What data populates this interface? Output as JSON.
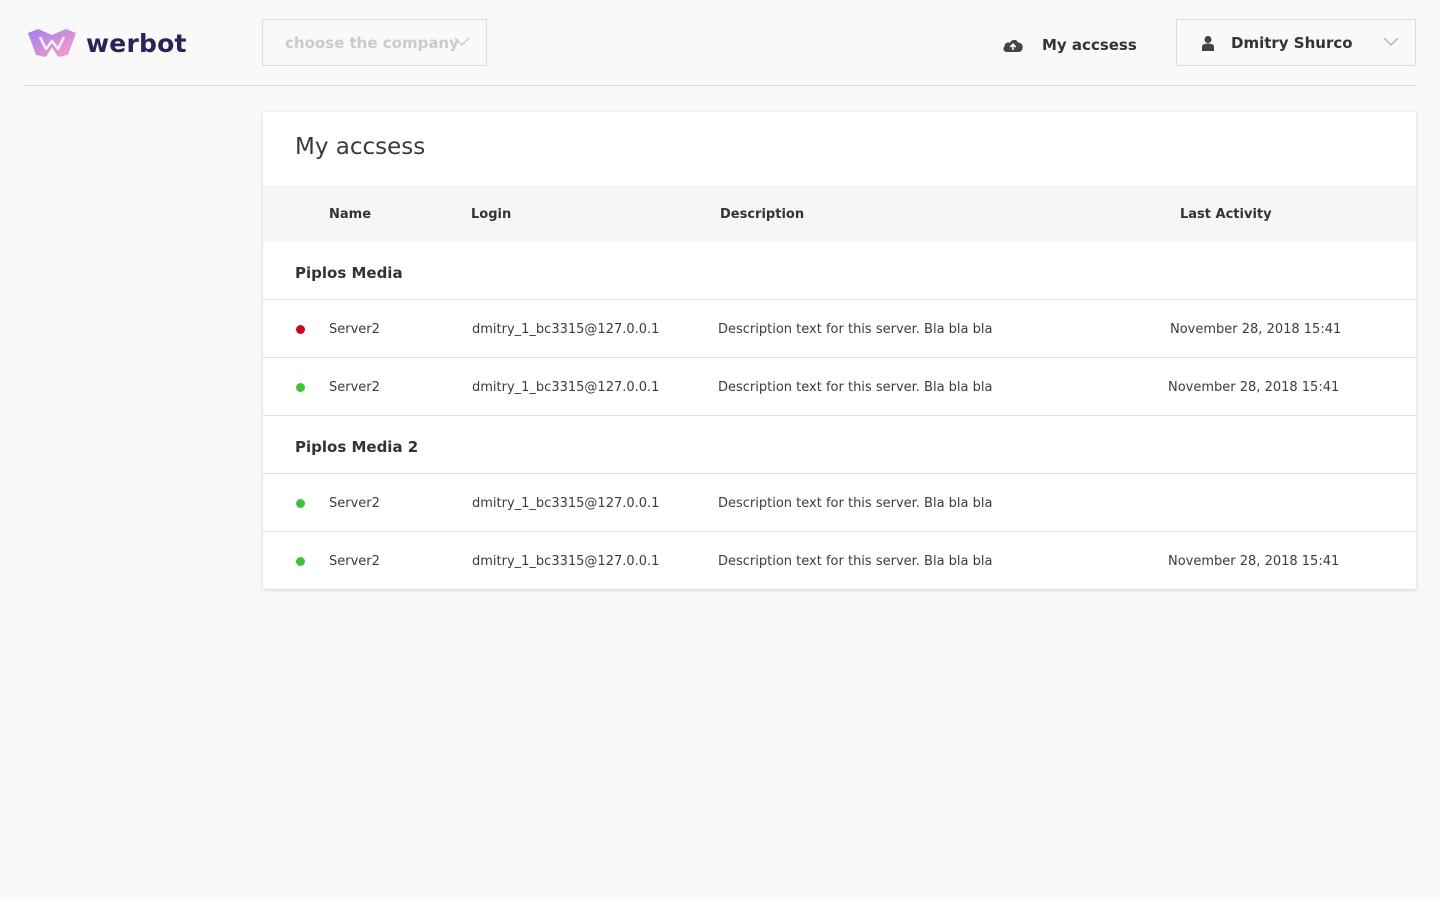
{
  "brand": {
    "name": "werbot",
    "accent": "#2c2257",
    "logo_gradient": [
      "#a57cf0",
      "#f7a3c4"
    ]
  },
  "header": {
    "company_select": {
      "placeholder": "choose the company",
      "icon": "chevron-down-icon"
    },
    "access_link": {
      "label": "My accsess",
      "icon": "cloud-upload-icon"
    },
    "user_menu": {
      "name": "Dmitry Shurco",
      "icon": "user-icon",
      "chevron": "chevron-down-icon"
    }
  },
  "card": {
    "title": "My accsess",
    "columns": {
      "name": "Name",
      "login": "Login",
      "description": "Description",
      "last_activity": "Last Activity"
    },
    "status_colors": {
      "offline": "#d0021b",
      "online": "#3ec33b"
    },
    "groups": [
      {
        "name": "Piplos Media",
        "rows": [
          {
            "status": "offline",
            "name": "Server2",
            "login": "dmitry_1_bc3315@127.0.0.1",
            "description": "Description text for this server. Bla bla bla",
            "last_activity": "November 28, 2018 15:41"
          },
          {
            "status": "online",
            "name": "Server2",
            "login": "dmitry_1_bc3315@127.0.0.1",
            "description": "Description text for this server. Bla bla bla",
            "last_activity": "November 28, 2018 15:41"
          }
        ]
      },
      {
        "name": "Piplos Media 2",
        "rows": [
          {
            "status": "online",
            "name": "Server2",
            "login": "dmitry_1_bc3315@127.0.0.1",
            "description": "Description text for this server. Bla bla bla",
            "last_activity": ""
          },
          {
            "status": "online",
            "name": "Server2",
            "login": "dmitry_1_bc3315@127.0.0.1",
            "description": "Description text for this server. Bla bla bla",
            "last_activity": "November 28, 2018 15:41"
          }
        ]
      }
    ]
  }
}
